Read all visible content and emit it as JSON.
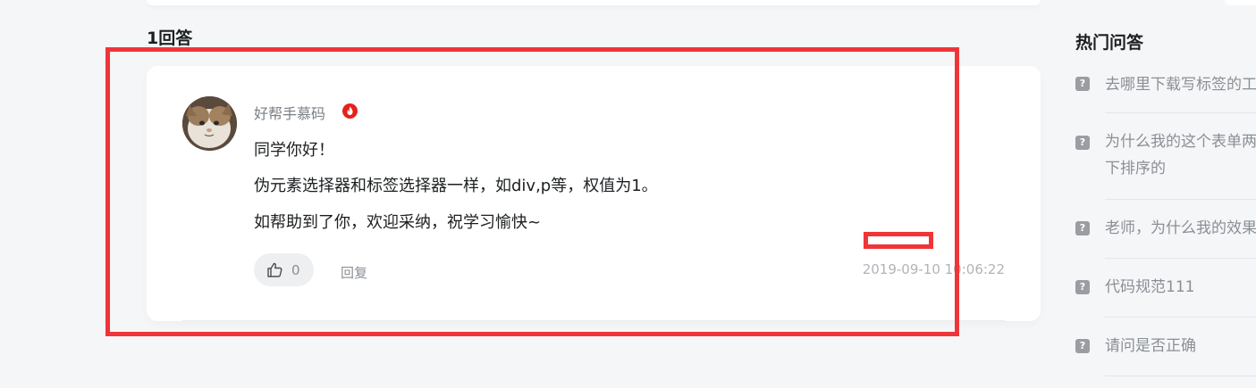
{
  "answer_section": {
    "count_label": "1回答"
  },
  "answer": {
    "username": "好帮手慕码",
    "badge_icon": "hot-flame-icon",
    "lines": [
      "同学你好！",
      "伪元素选择器和标签选择器一样，如div,p等，权值为1。",
      "如帮助到了你，欢迎采纳，祝学习愉快~"
    ],
    "like_count": "0",
    "reply_label": "回复",
    "timestamp": "2019-09-10 10:06:22"
  },
  "sidebar": {
    "title": "热门问答",
    "items": [
      {
        "text": "去哪里下载写标签的工"
      },
      {
        "text": "为什么我的这个表单两",
        "text2": "下排序的"
      },
      {
        "text": "老师，为什么我的效果"
      },
      {
        "text": "代码规范111"
      },
      {
        "text": "请问是否正确"
      }
    ]
  },
  "colors": {
    "highlight": "#ef3538",
    "badge": "#e5231b",
    "background": "#f5f6f8"
  }
}
